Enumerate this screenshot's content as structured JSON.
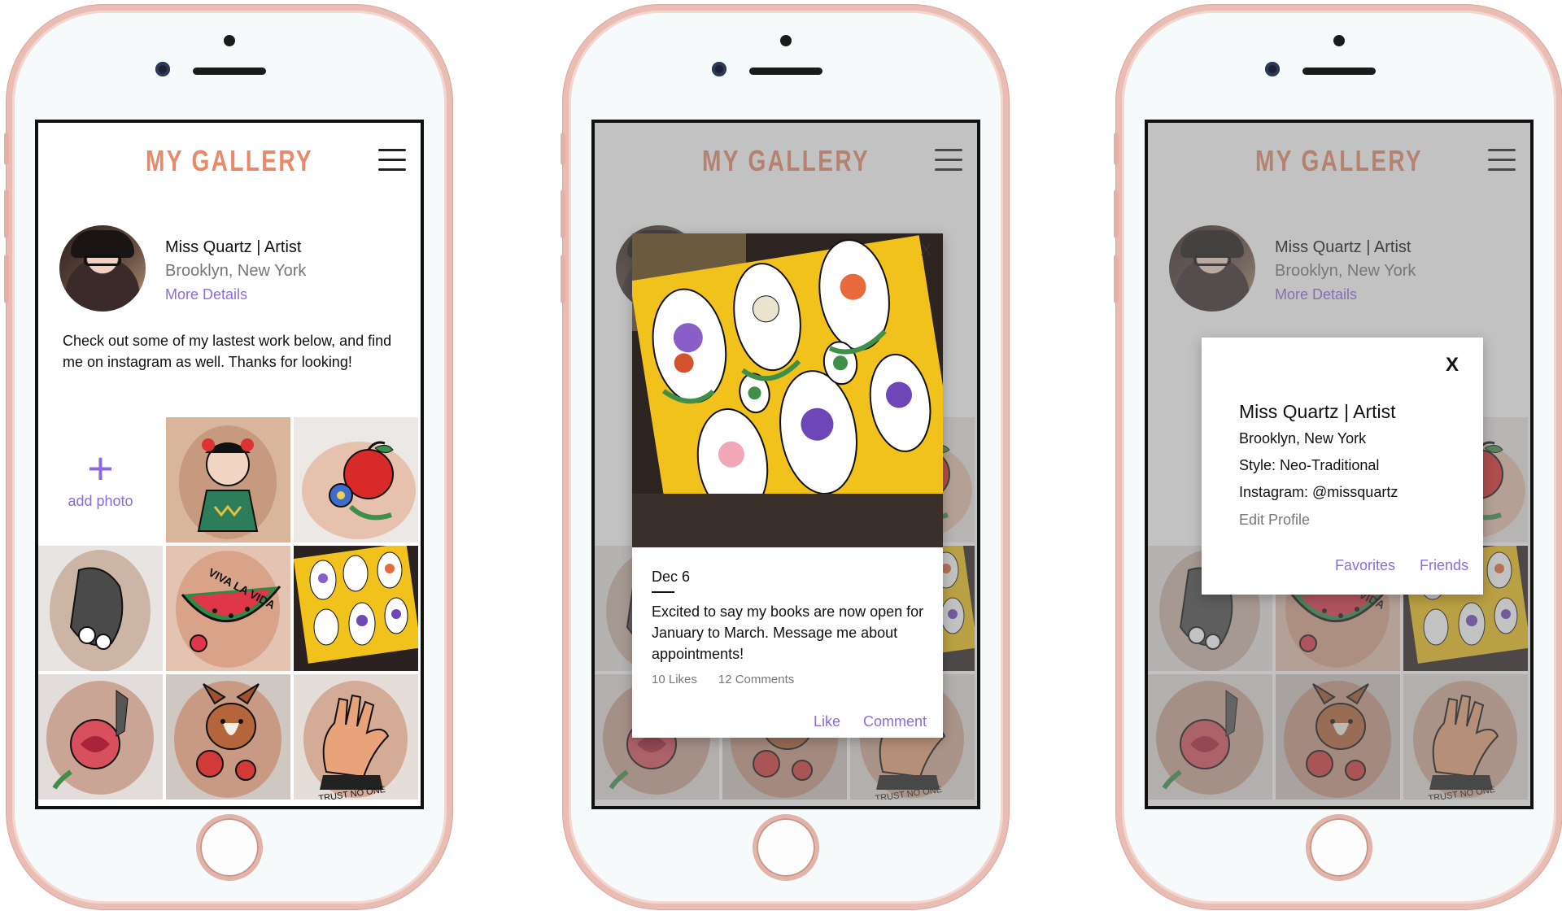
{
  "app": {
    "title": "MY GALLERY"
  },
  "profile": {
    "name": "Miss Quartz | Artist",
    "location": "Brooklyn, New York",
    "more_details": "More Details",
    "bio": "Check out some of my lastest work below, and find me on instagram as well. Thanks for looking!"
  },
  "gallery": {
    "add_photo": "add photo"
  },
  "post": {
    "date": "Dec 6",
    "text": "Excited to say my books are now open for January to March. Message me about appointments!",
    "likes": "10 Likes",
    "comments": "12 Comments",
    "like_button": "Like",
    "comment_button": "Comment"
  },
  "details": {
    "close": "X",
    "name": "Miss Quartz | Artist",
    "location": "Brooklyn, New York",
    "style": "Style: Neo-Traditional",
    "instagram": "Instagram: @missquartz",
    "edit_profile": "Edit Profile",
    "favorites": "Favorites",
    "friends": "Friends"
  },
  "colors": {
    "accent": "#8c6be0",
    "logo": "#e8896a",
    "phone_frame": "#e9bdb4"
  }
}
